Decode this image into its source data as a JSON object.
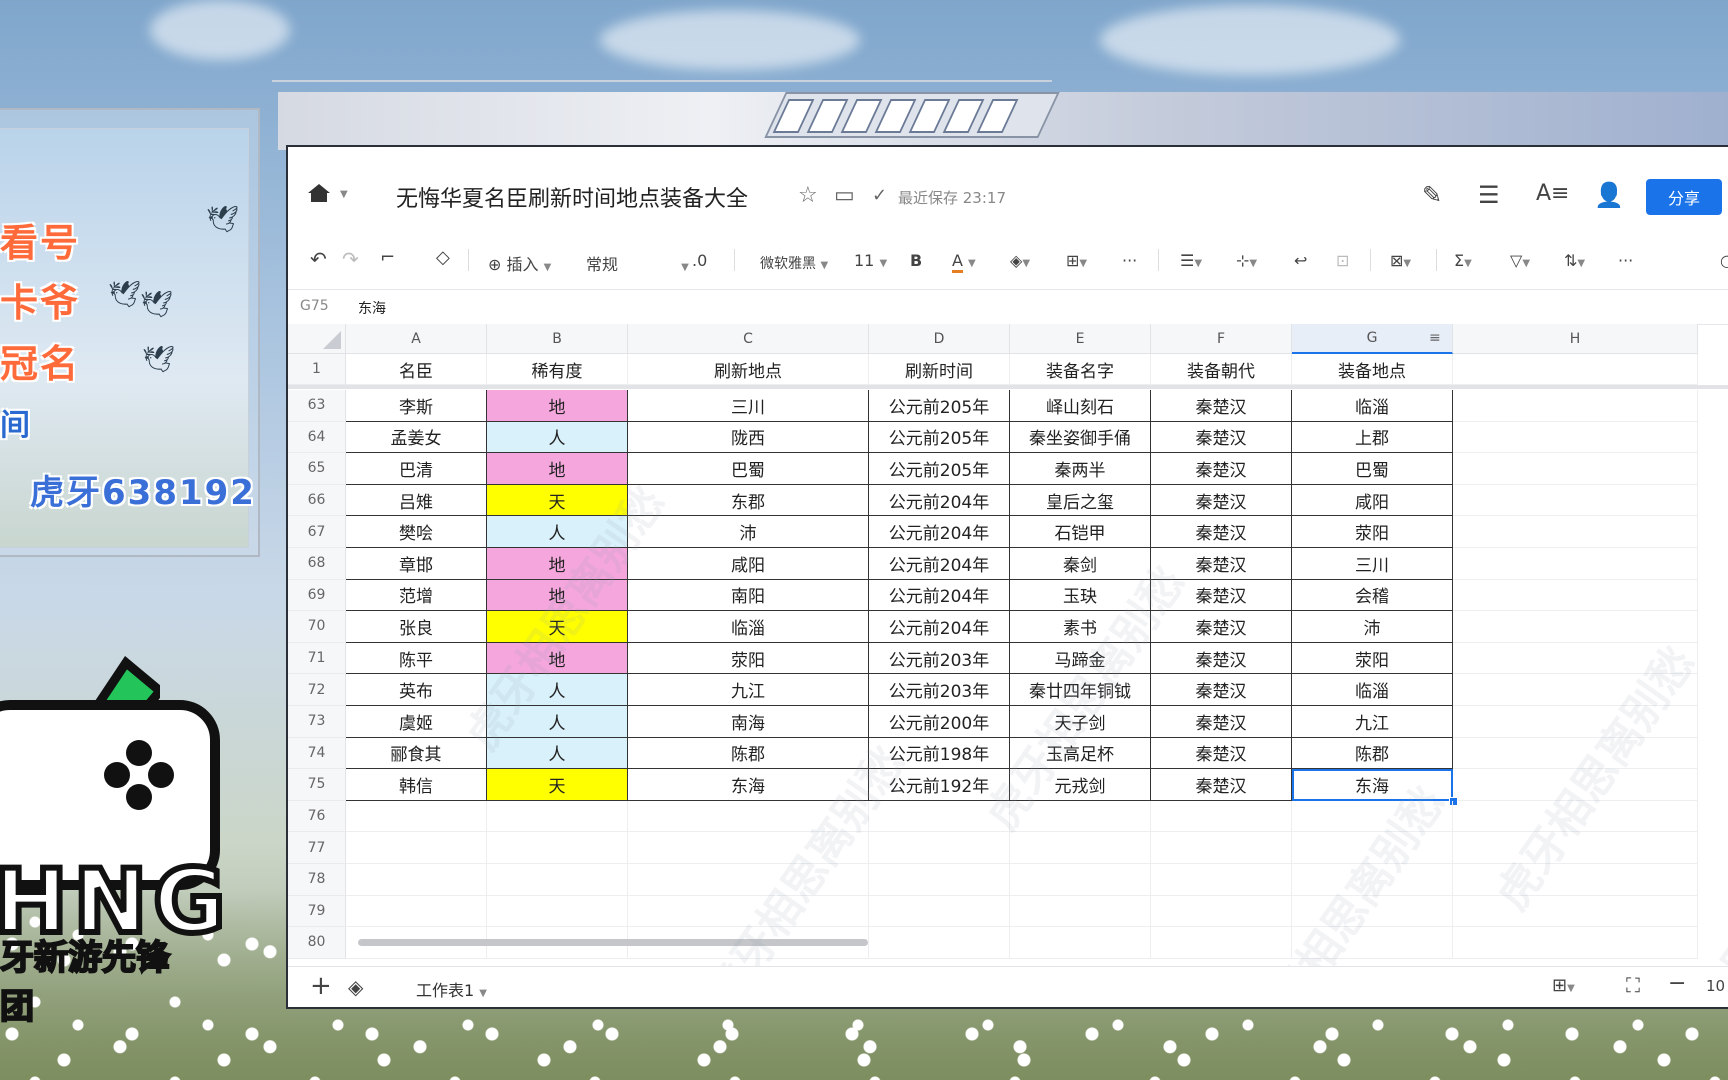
{
  "promo": {
    "line1": "看号",
    "line2": "卡爷",
    "line3": "冠名",
    "line4": "间",
    "channel_id": "虎牙638192"
  },
  "logo": {
    "brand": "HNG",
    "team": "牙新游先锋团"
  },
  "titlebar": {
    "doc_title": "无悔华夏名臣刷新时间地点装备大全",
    "save_status": "最近保存 23:17",
    "share_label": "分享"
  },
  "toolbar": {
    "insert_label": "插入",
    "format_label": "常规",
    "decimal_label": ".0",
    "font_label": "微软雅黑",
    "size_label": "11",
    "bold_label": "B",
    "font_color_label": "A",
    "more_label": "···"
  },
  "formula_bar": {
    "cell_ref": "G75",
    "value": "东海"
  },
  "columns": [
    "A",
    "B",
    "C",
    "D",
    "E",
    "F",
    "G",
    "H"
  ],
  "header_row": {
    "row_num": "1",
    "cells": [
      "名臣",
      "稀有度",
      "刷新地点",
      "刷新时间",
      "装备名字",
      "装备朝代",
      "装备地点"
    ]
  },
  "rows": [
    {
      "num": "63",
      "cells": [
        "李斯",
        "地",
        "三川",
        "公元前205年",
        "峄山刻石",
        "秦楚汉",
        "临淄"
      ]
    },
    {
      "num": "64",
      "cells": [
        "孟姜女",
        "人",
        "陇西",
        "公元前205年",
        "秦坐姿御手俑",
        "秦楚汉",
        "上郡"
      ]
    },
    {
      "num": "65",
      "cells": [
        "巴清",
        "地",
        "巴蜀",
        "公元前205年",
        "秦两半",
        "秦楚汉",
        "巴蜀"
      ]
    },
    {
      "num": "66",
      "cells": [
        "吕雉",
        "天",
        "东郡",
        "公元前204年",
        "皇后之玺",
        "秦楚汉",
        "咸阳"
      ]
    },
    {
      "num": "67",
      "cells": [
        "樊哙",
        "人",
        "沛",
        "公元前204年",
        "石铠甲",
        "秦楚汉",
        "荥阳"
      ]
    },
    {
      "num": "68",
      "cells": [
        "章邯",
        "地",
        "咸阳",
        "公元前204年",
        "秦剑",
        "秦楚汉",
        "三川"
      ]
    },
    {
      "num": "69",
      "cells": [
        "范增",
        "地",
        "南阳",
        "公元前204年",
        "玉玦",
        "秦楚汉",
        "会稽"
      ]
    },
    {
      "num": "70",
      "cells": [
        "张良",
        "天",
        "临淄",
        "公元前204年",
        "素书",
        "秦楚汉",
        "沛"
      ]
    },
    {
      "num": "71",
      "cells": [
        "陈平",
        "地",
        "荥阳",
        "公元前203年",
        "马蹄金",
        "秦楚汉",
        "荥阳"
      ]
    },
    {
      "num": "72",
      "cells": [
        "英布",
        "人",
        "九江",
        "公元前203年",
        "秦廿四年铜钺",
        "秦楚汉",
        "临淄"
      ]
    },
    {
      "num": "73",
      "cells": [
        "虞姬",
        "人",
        "南海",
        "公元前200年",
        "天子剑",
        "秦楚汉",
        "九江"
      ]
    },
    {
      "num": "74",
      "cells": [
        "郦食其",
        "人",
        "陈郡",
        "公元前198年",
        "玉高足杯",
        "秦楚汉",
        "陈郡"
      ]
    },
    {
      "num": "75",
      "cells": [
        "韩信",
        "天",
        "东海",
        "公元前192年",
        "元戎剑",
        "秦楚汉",
        "东海"
      ]
    }
  ],
  "empty_rows": [
    "76",
    "77",
    "78",
    "79",
    "80"
  ],
  "rarity_colors": {
    "天": "#ffff00",
    "地": "#f4a6dd",
    "人": "#d9f1fa"
  },
  "sheet": {
    "tab_label": "工作表1",
    "zoom": "10"
  },
  "watermark_text": "虎牙相思离别愁"
}
